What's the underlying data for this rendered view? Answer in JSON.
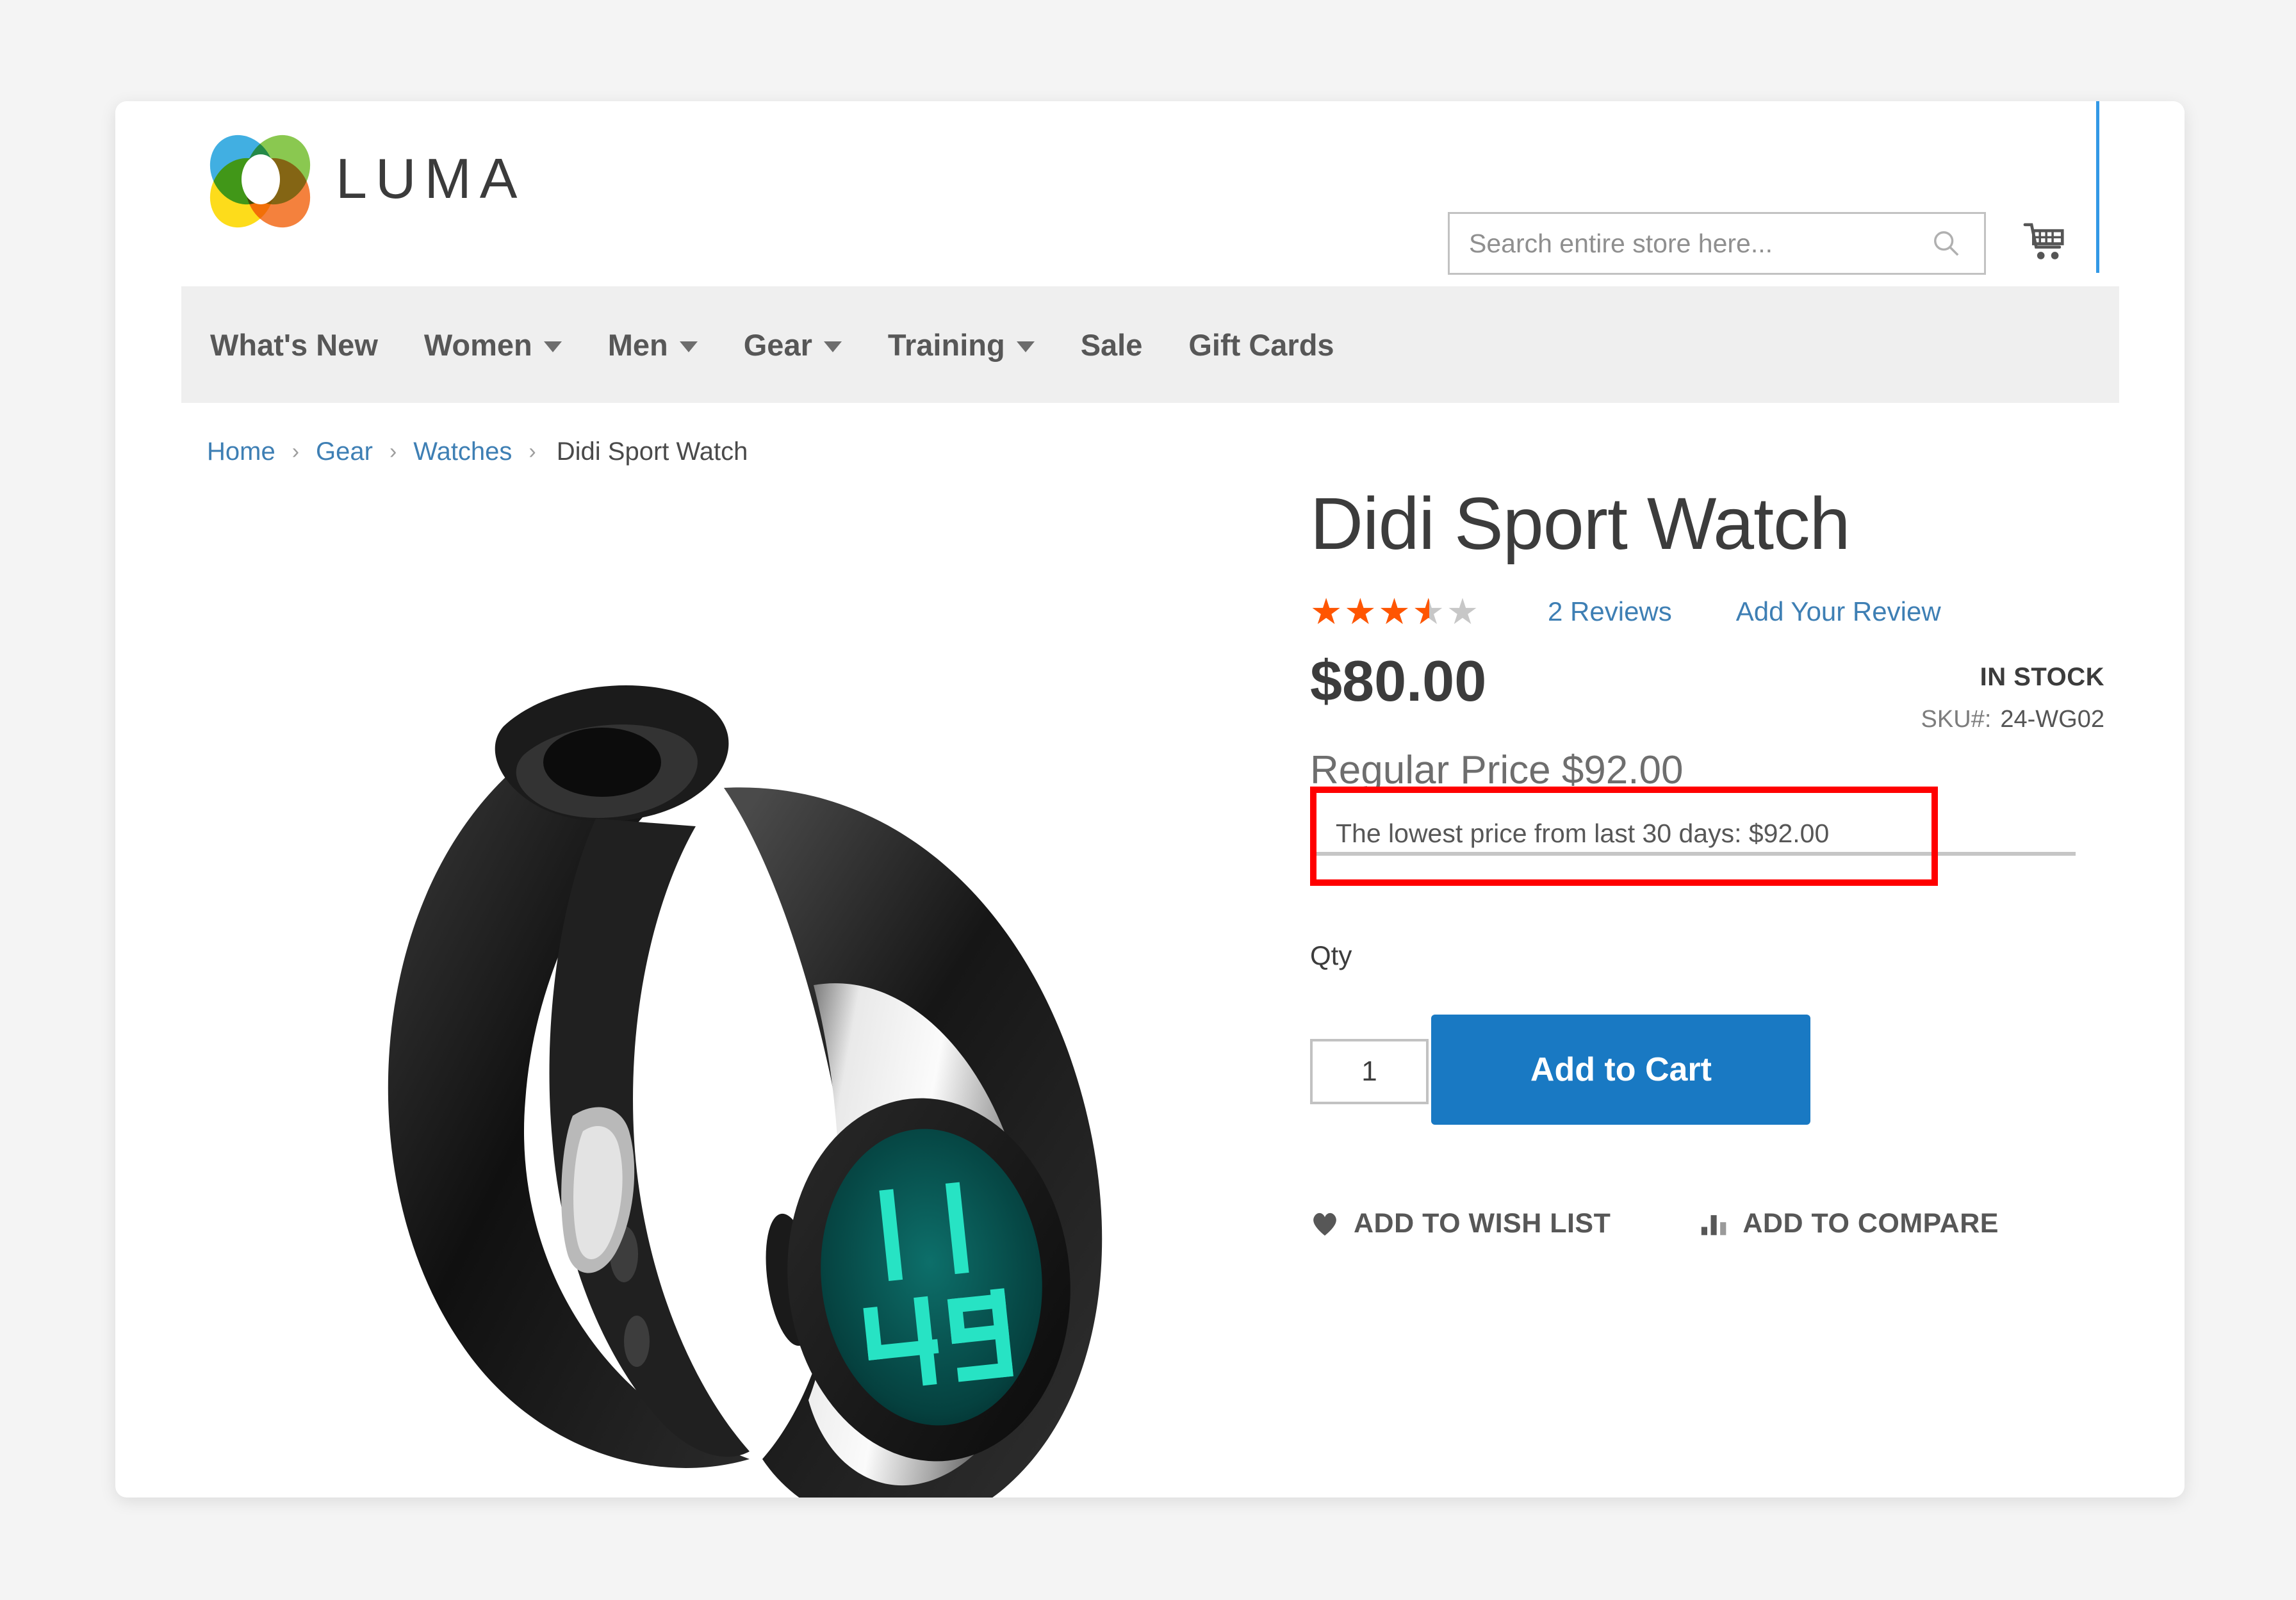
{
  "brand": {
    "name": "LUMA",
    "logo_icon": "luma-petals-logo"
  },
  "header": {
    "search": {
      "placeholder": "Search entire store here...",
      "value": "",
      "icon": "search-icon"
    },
    "cart_icon": "shopping-cart-icon"
  },
  "nav": {
    "items": [
      {
        "label": "What's New",
        "has_menu": false
      },
      {
        "label": "Women",
        "has_menu": true
      },
      {
        "label": "Men",
        "has_menu": true
      },
      {
        "label": "Gear",
        "has_menu": true
      },
      {
        "label": "Training",
        "has_menu": true
      },
      {
        "label": "Sale",
        "has_menu": false
      },
      {
        "label": "Gift Cards",
        "has_menu": false
      }
    ]
  },
  "breadcrumb": {
    "items": [
      "Home",
      "Gear",
      "Watches"
    ],
    "current": "Didi Sport Watch",
    "separator": "›"
  },
  "product": {
    "title": "Didi Sport Watch",
    "image_alt": "Didi Sport Watch black band silver case teal LCD display",
    "display_time_top": "11",
    "display_time_bottom": "49",
    "rating": {
      "value": 3.5,
      "max": 5,
      "percent": "70%",
      "reviews_label": "2  Reviews",
      "add_review_label": "Add Your Review"
    },
    "price": "$80.00",
    "stock_status": "IN STOCK",
    "sku_label": "SKU#:",
    "sku_value": "24-WG02",
    "regular_price_label": "Regular Price $92.00",
    "lowest_price_note": "The lowest price from last 30 days: $92.00",
    "qty_label": "Qty",
    "qty_value": "1",
    "add_to_cart_label": "Add to Cart",
    "wishlist_label": "ADD TO WISH LIST",
    "compare_label": "ADD TO COMPARE"
  },
  "colors": {
    "accent_blue": "#1979c3",
    "link_blue": "#3e7fb4",
    "star_orange": "#ff5501",
    "highlight_red": "#ff0000",
    "nav_bg": "#efefef",
    "page_bg": "#f4f4f4"
  }
}
